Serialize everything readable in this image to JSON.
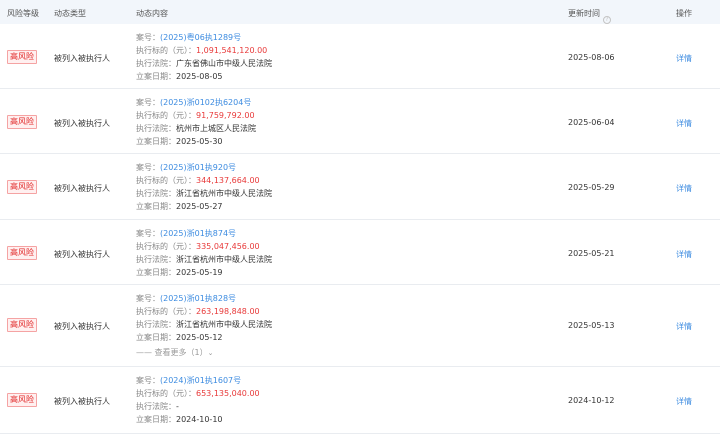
{
  "header": {
    "risk_level": "风险等级",
    "event_type": "动态类型",
    "content": "动态内容",
    "updated_time": "更新时间",
    "action": "操作",
    "info_icon_glyph": "?"
  },
  "labels": {
    "case_no": "案号：",
    "amount": "执行标的（元）：",
    "court": "执行法院：",
    "filing_date": "立案日期：",
    "detail": "详情"
  },
  "rows": [
    {
      "risk": "高风险",
      "type": "被列入被执行人",
      "case_no": "(2025)粤06执1289号",
      "amount": "1,091,541,120.00",
      "court": "广东省佛山市中级人民法院",
      "filing_date": "2025-08-05",
      "updated": "2025-08-06",
      "more": ""
    },
    {
      "risk": "高风险",
      "type": "被列入被执行人",
      "case_no": "(2025)浙0102执6204号",
      "amount": "91,759,792.00",
      "court": "杭州市上城区人民法院",
      "filing_date": "2025-05-30",
      "updated": "2025-06-04",
      "more": ""
    },
    {
      "risk": "高风险",
      "type": "被列入被执行人",
      "case_no": "(2025)浙01执920号",
      "amount": "344,137,664.00",
      "court": "浙江省杭州市中级人民法院",
      "filing_date": "2025-05-27",
      "updated": "2025-05-29",
      "more": ""
    },
    {
      "risk": "高风险",
      "type": "被列入被执行人",
      "case_no": "(2025)浙01执874号",
      "amount": "335,047,456.00",
      "court": "浙江省杭州市中级人民法院",
      "filing_date": "2025-05-19",
      "updated": "2025-05-21",
      "more": ""
    },
    {
      "risk": "高风险",
      "type": "被列入被执行人",
      "case_no": "(2025)浙01执828号",
      "amount": "263,198,848.00",
      "court": "浙江省杭州市中级人民法院",
      "filing_date": "2025-05-12",
      "updated": "2025-05-13",
      "more": "—— 查看更多（1）"
    },
    {
      "risk": "高风险",
      "type": "被列入被执行人",
      "case_no": "(2024)浙01执1607号",
      "amount": "653,135,040.00",
      "court": "-",
      "filing_date": "2024-10-10",
      "updated": "2024-10-12",
      "more": ""
    }
  ]
}
